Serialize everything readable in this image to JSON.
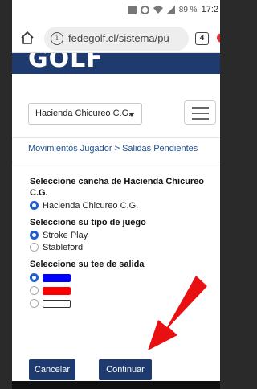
{
  "status_bar": {
    "battery": "89 %",
    "time": "17:2"
  },
  "browser": {
    "url": "fedegolf.cl/sistema/pu",
    "tab_count": "4"
  },
  "site": {
    "logo_text": "GOLF"
  },
  "club_select": {
    "value": "Hacienda Chicureo C.G."
  },
  "breadcrumb": "Movimientos Jugador > Salidas Pendientes",
  "form": {
    "course_title": "Seleccione cancha de Hacienda Chicureo C.G.",
    "course_option": "Hacienda Chicureo C.G.",
    "game_title": "Seleccione su tipo de juego",
    "game_options": [
      "Stroke Play",
      "Stableford"
    ],
    "game_selected": "Stroke Play",
    "tee_title": "Seleccione su tee de salida",
    "tees": [
      {
        "color": "#0000ff",
        "selected": true
      },
      {
        "color": "#ff0000",
        "selected": false
      },
      {
        "color": "#ffffff",
        "selected": false
      }
    ]
  },
  "buttons": {
    "cancel": "Cancelar",
    "continue": "Continuar"
  },
  "annotation": {
    "arrow_color": "#e81010"
  },
  "colors": {
    "brand": "#1f3a6e",
    "link": "#1f4f8f",
    "radio": "#1f5ecf"
  }
}
